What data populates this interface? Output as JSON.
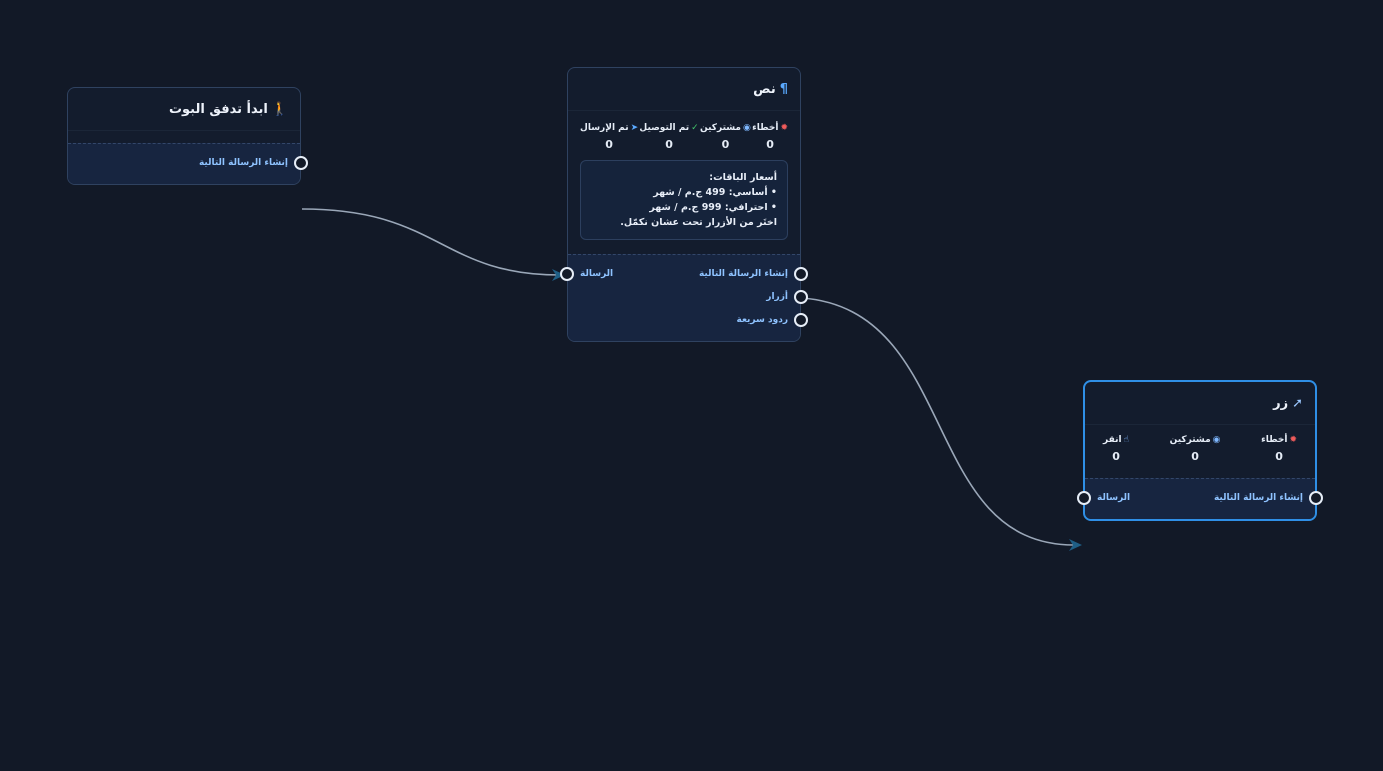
{
  "start_node": {
    "title": "ابدأ تدفق البوت",
    "icon": "walking-person-icon",
    "out_port": "إنشاء الرسالة التالية"
  },
  "text_node": {
    "title": "نص",
    "icon": "paragraph-icon",
    "stats": [
      {
        "label": "أخطاء",
        "icon": "bug-icon",
        "value": "0"
      },
      {
        "label": "مشتركين",
        "icon": "user-circle-icon",
        "value": "0"
      },
      {
        "label": "تم التوصيل",
        "icon": "check-circle-icon",
        "value": "0"
      },
      {
        "label": "تم الإرسال",
        "icon": "send-icon",
        "value": "0"
      }
    ],
    "message_lines": [
      "أسعار الباقات:",
      "• أساسي: 499 ج.م / شهر",
      "• احترافي: 999 ج.م / شهر",
      "اختَر من الأزرار تحت عشان نكمّل."
    ],
    "in_port": "الرسالة",
    "out_ports": [
      "إنشاء الرسالة التالية",
      "أزرار",
      "ردود سريعة"
    ]
  },
  "button_node": {
    "title": "زر",
    "icon": "cursor-icon",
    "stats": [
      {
        "label": "أخطاء",
        "icon": "bug-icon",
        "value": "0"
      },
      {
        "label": "مشتركين",
        "icon": "user-circle-icon",
        "value": "0"
      },
      {
        "label": "انقر",
        "icon": "click-hand-icon",
        "value": "0"
      }
    ],
    "in_port": "الرسالة",
    "out_port": "إنشاء الرسالة التالية"
  },
  "colors": {
    "background": "#121927",
    "node_bg": "#131c2d",
    "port_bg": "#172540",
    "port_label": "#8fc3ff",
    "selected_border": "#2f8fe6",
    "edge": "#9aa7b8",
    "arrow": "#1f5f86",
    "bug": "#ef5b5b",
    "check": "#43c46b",
    "user": "#7fb8ff",
    "send": "#5aa9ff"
  }
}
